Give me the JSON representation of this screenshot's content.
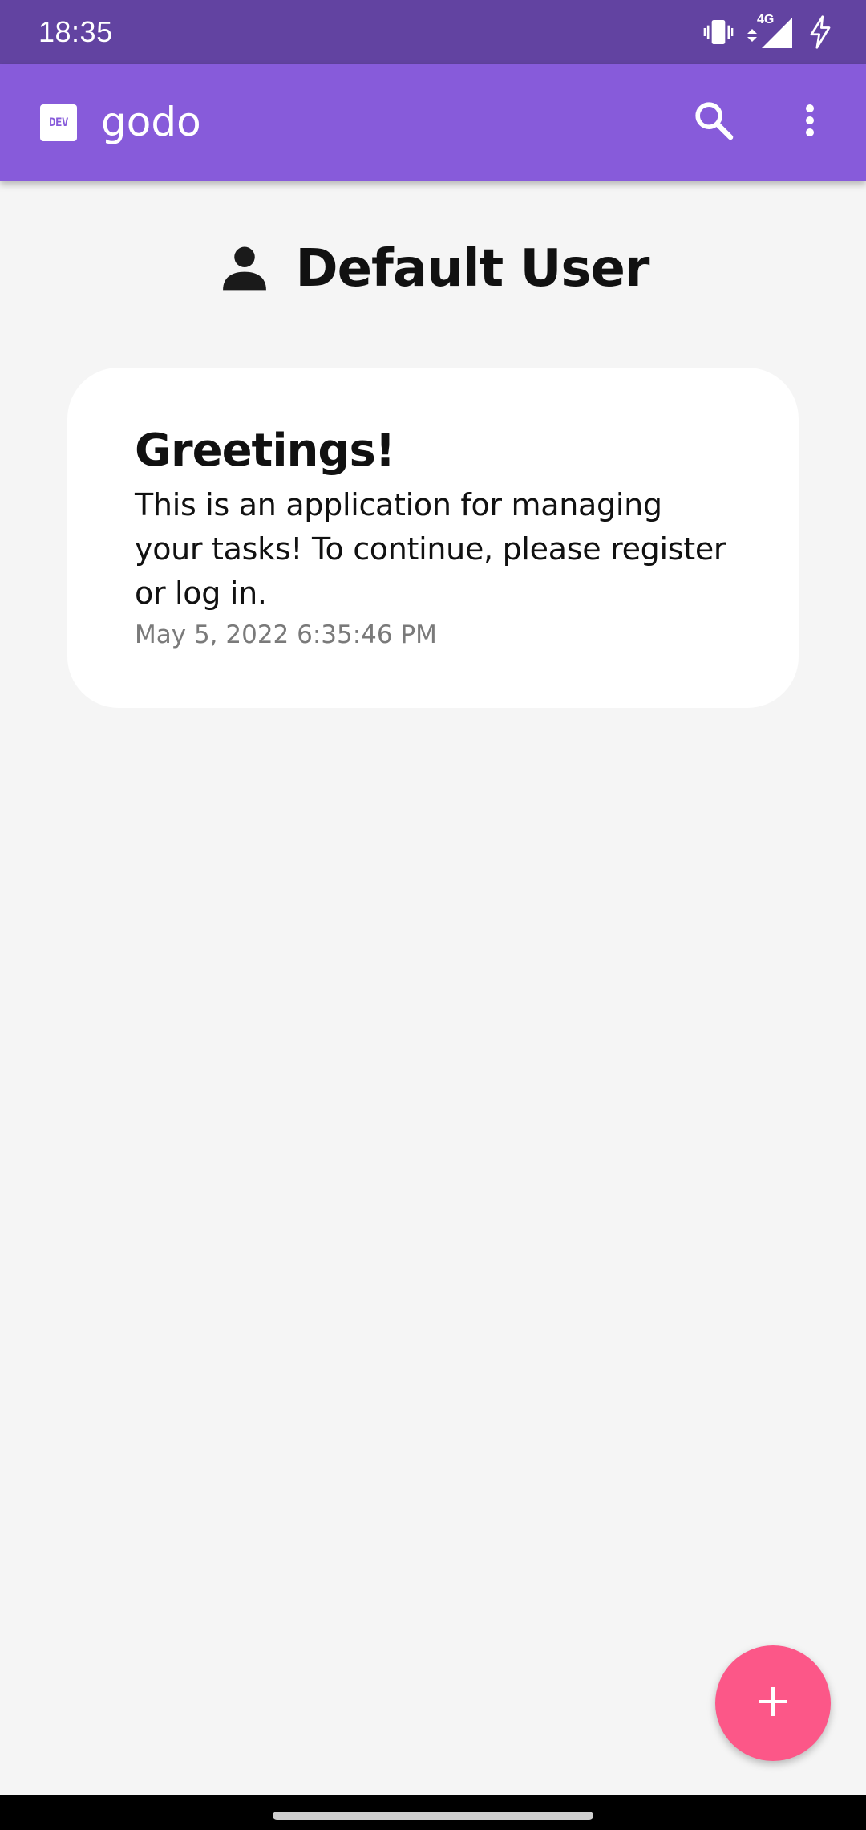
{
  "status_bar": {
    "time": "18:35",
    "network_label": "4G",
    "icons": [
      "vibrate-icon",
      "network-signal-icon",
      "charging-icon"
    ]
  },
  "app_bar": {
    "logo_text": "DEV",
    "title": "godo",
    "icons": [
      "search-icon",
      "more-vert-icon"
    ]
  },
  "user": {
    "name": "Default User",
    "icon": "person-icon"
  },
  "card": {
    "title": "Greetings!",
    "body": "This is an application for managing your tasks! To continue, please register or log in.",
    "date": "May 5, 2022 6:35:46 PM"
  },
  "fab": {
    "icon": "add-icon"
  },
  "colors": {
    "status_bar": "#6243a1",
    "app_bar": "#875bda",
    "background": "#f5f5f5",
    "card": "#ffffff",
    "fab": "#fc5788",
    "date_text": "#7a7a7a"
  }
}
